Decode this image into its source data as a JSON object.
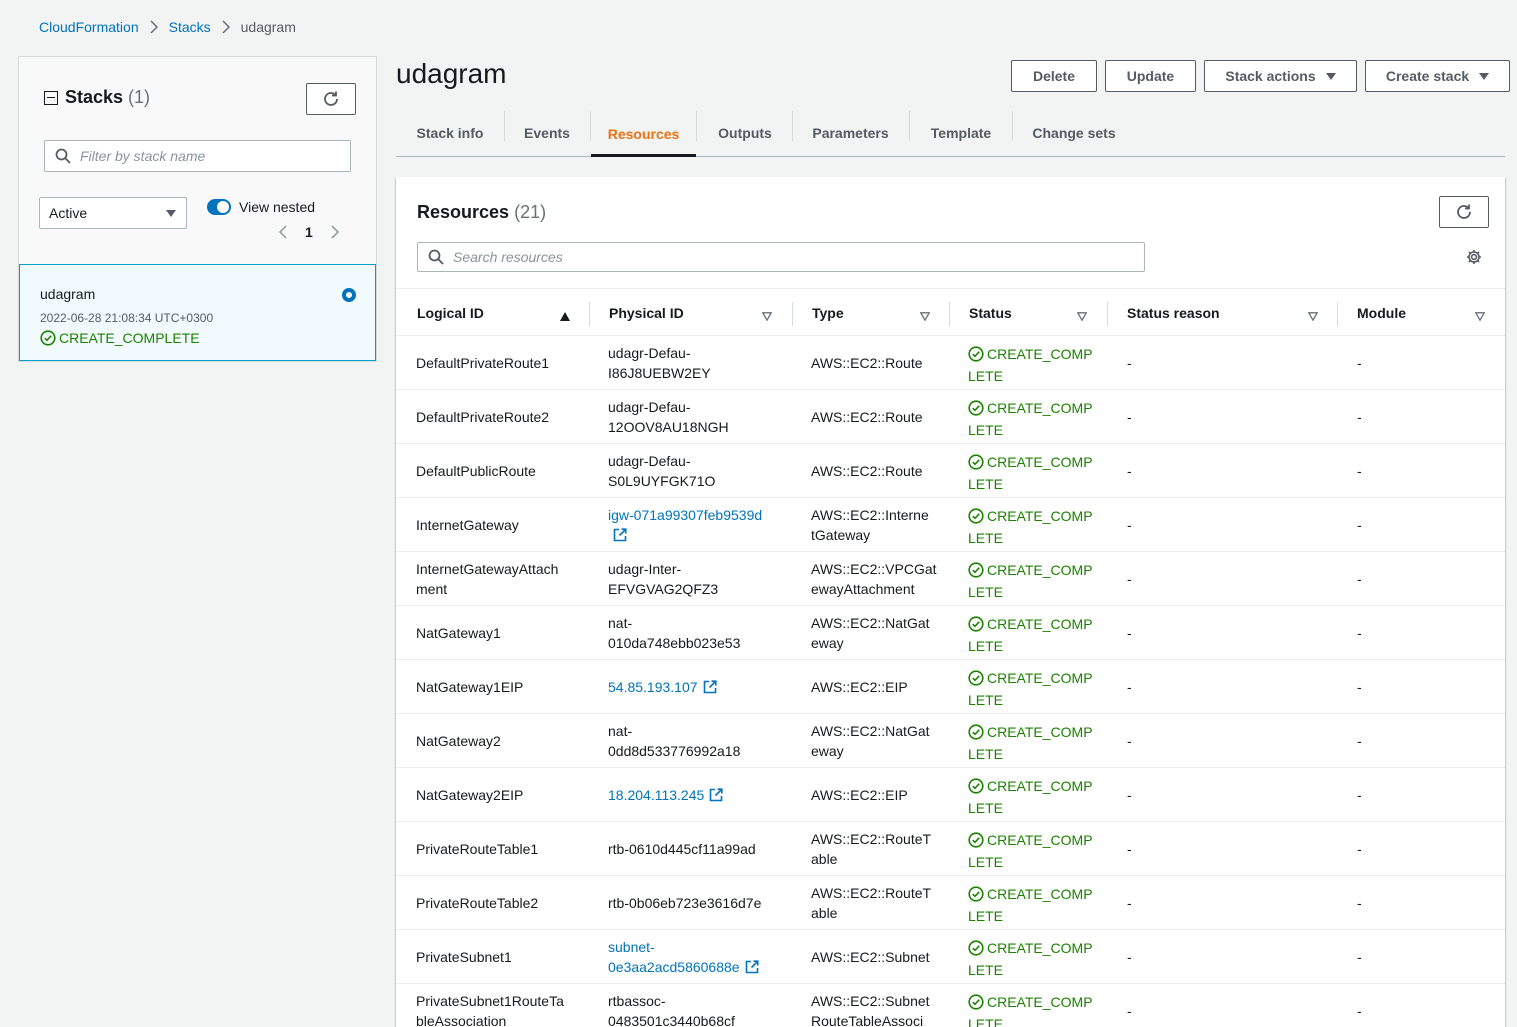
{
  "breadcrumb": {
    "root": "CloudFormation",
    "stacks": "Stacks",
    "current": "udagram"
  },
  "sidebar": {
    "title": "Stacks",
    "count": "(1)",
    "filter_placeholder": "Filter by stack name",
    "status_select": "Active",
    "view_nested_label": "View nested",
    "page_number": "1",
    "stack": {
      "name": "udagram",
      "date": "2022-06-28 21:08:34 UTC+0300",
      "status": "CREATE_COMPLETE"
    }
  },
  "header": {
    "title": "udagram",
    "buttons": {
      "delete": "Delete",
      "update": "Update",
      "stack_actions": "Stack actions",
      "create_stack": "Create stack"
    }
  },
  "tabs": [
    "Stack info",
    "Events",
    "Resources",
    "Outputs",
    "Parameters",
    "Template",
    "Change sets"
  ],
  "resources": {
    "title": "Resources",
    "count": "(21)",
    "search_placeholder": "Search resources",
    "columns": [
      "Logical ID",
      "Physical ID",
      "Type",
      "Status",
      "Status reason",
      "Module"
    ],
    "rows": [
      {
        "logical_a": "DefaultPrivateRoute1",
        "logical_b": "",
        "physical_a": "udagr-Defau-",
        "physical_b": "I86J8UEBW2EY",
        "link": false,
        "type_a": "AWS::EC2::Route",
        "type_b": "",
        "status_a": "CREATE_COMP",
        "status_b": "LETE",
        "reason": "-",
        "module": "-"
      },
      {
        "logical_a": "DefaultPrivateRoute2",
        "logical_b": "",
        "physical_a": "udagr-Defau-",
        "physical_b": "12OOV8AU18NGH",
        "link": false,
        "type_a": "AWS::EC2::Route",
        "type_b": "",
        "status_a": "CREATE_COMP",
        "status_b": "LETE",
        "reason": "-",
        "module": "-"
      },
      {
        "logical_a": "DefaultPublicRoute",
        "logical_b": "",
        "physical_a": "udagr-Defau-",
        "physical_b": "S0L9UYFGK71O",
        "link": false,
        "type_a": "AWS::EC2::Route",
        "type_b": "",
        "status_a": "CREATE_COMP",
        "status_b": "LETE",
        "reason": "-",
        "module": "-"
      },
      {
        "logical_a": "InternetGateway",
        "logical_b": "",
        "physical_a": "igw-071a99307feb9539d",
        "physical_b": "",
        "link": true,
        "type_a": "AWS::EC2::Interne",
        "type_b": "tGateway",
        "status_a": "CREATE_COMP",
        "status_b": "LETE",
        "reason": "-",
        "module": "-"
      },
      {
        "logical_a": "InternetGatewayAttach",
        "logical_b": "ment",
        "physical_a": "udagr-Inter-",
        "physical_b": "EFVGVAG2QFZ3",
        "link": false,
        "type_a": "AWS::EC2::VPCGat",
        "type_b": "ewayAttachment",
        "status_a": "CREATE_COMP",
        "status_b": "LETE",
        "reason": "-",
        "module": "-"
      },
      {
        "logical_a": "NatGateway1",
        "logical_b": "",
        "physical_a": "nat-",
        "physical_b": "010da748ebb023e53",
        "link": false,
        "type_a": "AWS::EC2::NatGat",
        "type_b": "eway",
        "status_a": "CREATE_COMP",
        "status_b": "LETE",
        "reason": "-",
        "module": "-"
      },
      {
        "logical_a": "NatGateway1EIP",
        "logical_b": "",
        "physical_a": "54.85.193.107",
        "physical_b": "",
        "link": true,
        "type_a": "AWS::EC2::EIP",
        "type_b": "",
        "status_a": "CREATE_COMP",
        "status_b": "LETE",
        "reason": "-",
        "module": "-"
      },
      {
        "logical_a": "NatGateway2",
        "logical_b": "",
        "physical_a": "nat-",
        "physical_b": "0dd8d533776992a18",
        "link": false,
        "type_a": "AWS::EC2::NatGat",
        "type_b": "eway",
        "status_a": "CREATE_COMP",
        "status_b": "LETE",
        "reason": "-",
        "module": "-"
      },
      {
        "logical_a": "NatGateway2EIP",
        "logical_b": "",
        "physical_a": "18.204.113.245",
        "physical_b": "",
        "link": true,
        "type_a": "AWS::EC2::EIP",
        "type_b": "",
        "status_a": "CREATE_COMP",
        "status_b": "LETE",
        "reason": "-",
        "module": "-"
      },
      {
        "logical_a": "PrivateRouteTable1",
        "logical_b": "",
        "physical_a": "rtb-0610d445cf11a99ad",
        "physical_b": "",
        "link": false,
        "type_a": "AWS::EC2::RouteT",
        "type_b": "able",
        "status_a": "CREATE_COMP",
        "status_b": "LETE",
        "reason": "-",
        "module": "-"
      },
      {
        "logical_a": "PrivateRouteTable2",
        "logical_b": "",
        "physical_a": "rtb-0b06eb723e3616d7e",
        "physical_b": "",
        "link": false,
        "type_a": "AWS::EC2::RouteT",
        "type_b": "able",
        "status_a": "CREATE_COMP",
        "status_b": "LETE",
        "reason": "-",
        "module": "-"
      },
      {
        "logical_a": "PrivateSubnet1",
        "logical_b": "",
        "physical_a": "subnet-",
        "physical_b": "0e3aa2acd5860688e",
        "link": true,
        "type_a": "AWS::EC2::Subnet",
        "type_b": "",
        "status_a": "CREATE_COMP",
        "status_b": "LETE",
        "reason": "-",
        "module": "-"
      },
      {
        "logical_a": "PrivateSubnet1RouteTa",
        "logical_b": "bleAssociation",
        "physical_a": "rtbassoc-",
        "physical_b": "0483501c3440b68cf",
        "link": false,
        "type_a": "AWS::EC2::Subnet",
        "type_b": "RouteTableAssoci",
        "status_a": "CREATE_COMP",
        "status_b": "LETE",
        "reason": "-",
        "module": "-"
      }
    ]
  },
  "colors": {
    "link": "#0073bb",
    "success": "#1d8102",
    "active_tab": "#ec7211",
    "selected_border": "#00a1c9"
  },
  "icons": [
    "chevron-right-icon",
    "collapse-icon",
    "refresh-icon",
    "search-icon",
    "caret-down-icon",
    "chevron-left-icon",
    "radio-selected-icon",
    "status-ok-icon",
    "settings-gear-icon",
    "sort-ascending-icon",
    "sort-icon",
    "external-link-icon"
  ]
}
